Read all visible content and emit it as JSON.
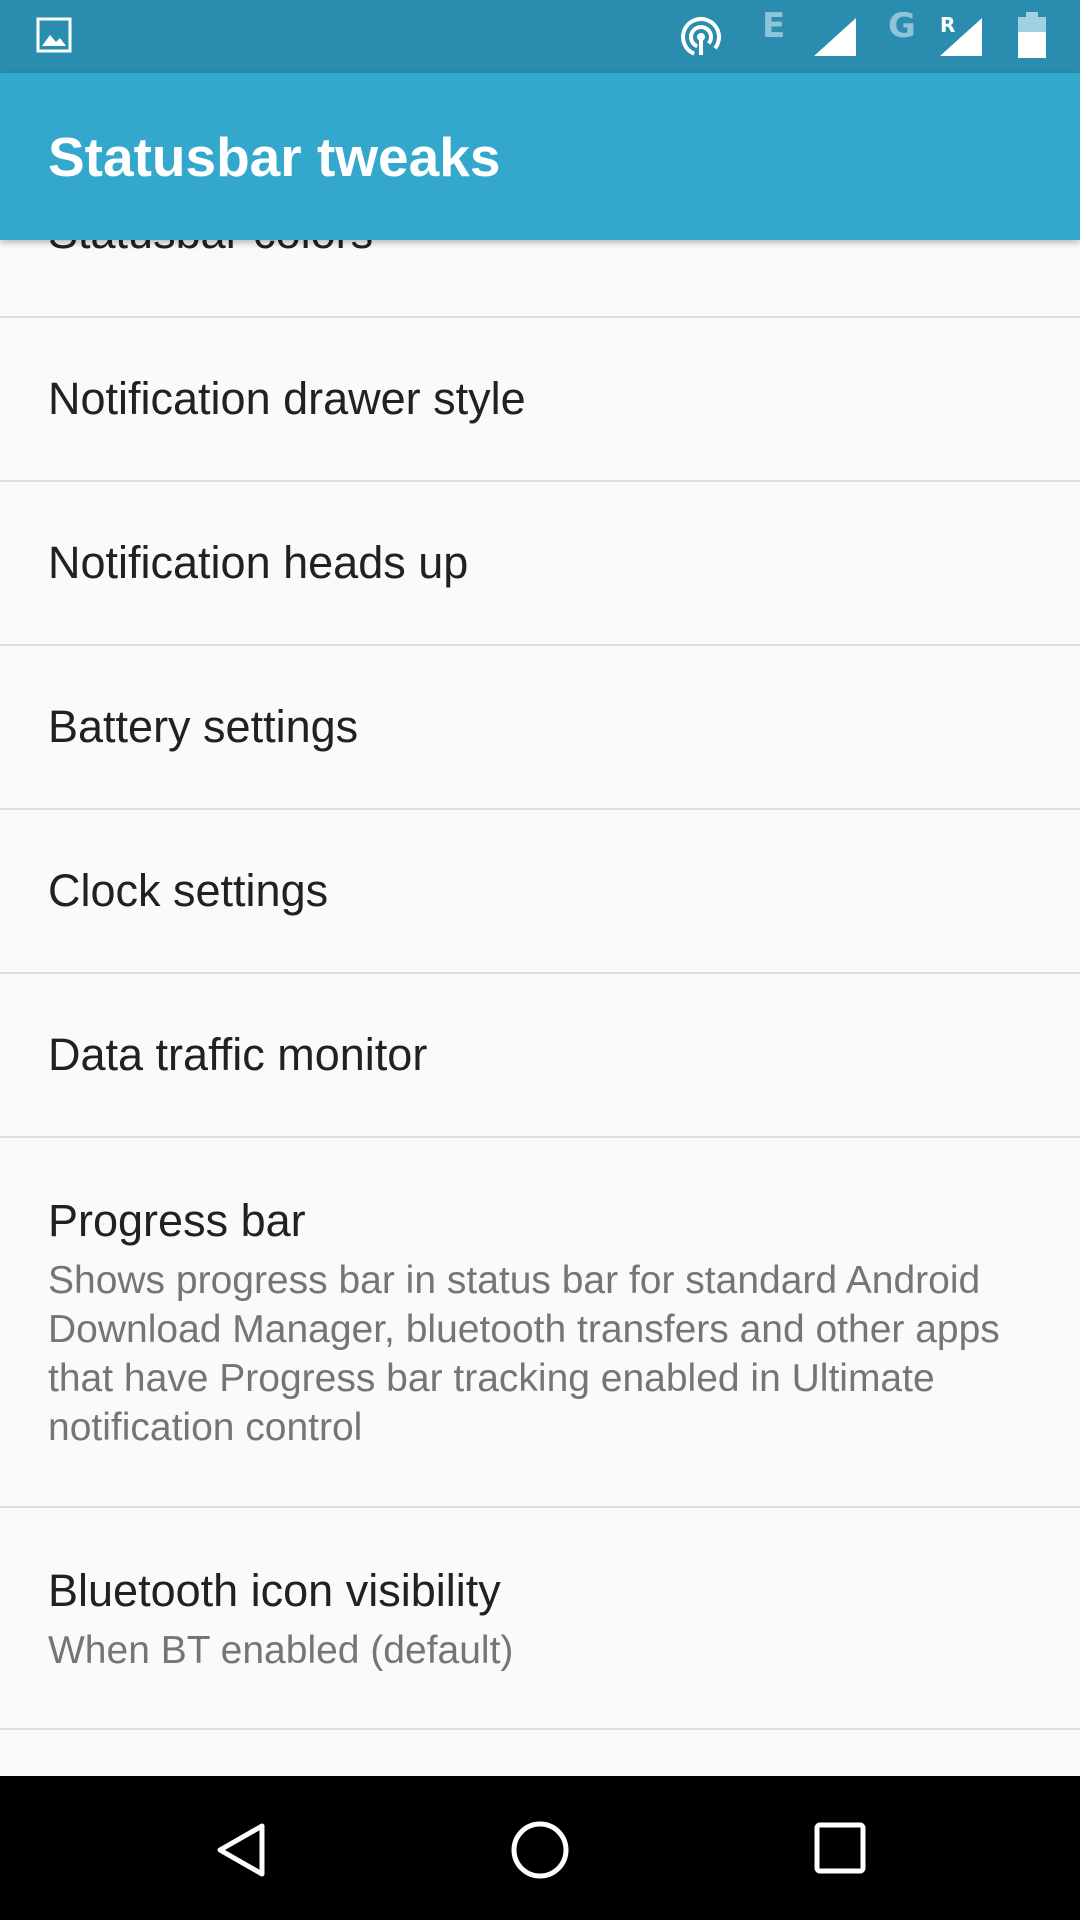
{
  "app_bar": {
    "title": "Statusbar tweaks"
  },
  "status_bar": {
    "network_letter_1": "E",
    "network_letter_2": "G",
    "roaming_letter": "R",
    "icons": [
      "gallery-icon",
      "hotspot-icon",
      "cell-signal-icon",
      "cell-signal-roaming-icon",
      "battery-icon"
    ]
  },
  "settings_list": {
    "partial_top_item": "Statusbar colors",
    "items": [
      {
        "title": "Notification drawer style"
      },
      {
        "title": "Notification heads up"
      },
      {
        "title": "Battery settings"
      },
      {
        "title": "Clock settings"
      },
      {
        "title": "Data traffic monitor"
      },
      {
        "title": "Progress bar",
        "summary": "Shows progress bar in status bar for standard Android Download Manager, bluetooth transfers and other apps that have Progress bar tracking enabled in Ultimate notification control"
      },
      {
        "title": "Bluetooth icon visibility",
        "summary": "When BT enabled (default)"
      }
    ]
  },
  "nav_bar": {
    "buttons": [
      "back-icon",
      "home-icon",
      "recents-icon"
    ]
  },
  "colors": {
    "status_bar": "#2a8cae",
    "app_bar": "#33a8cc",
    "background": "#fafafa",
    "nav_bar": "#000000"
  }
}
